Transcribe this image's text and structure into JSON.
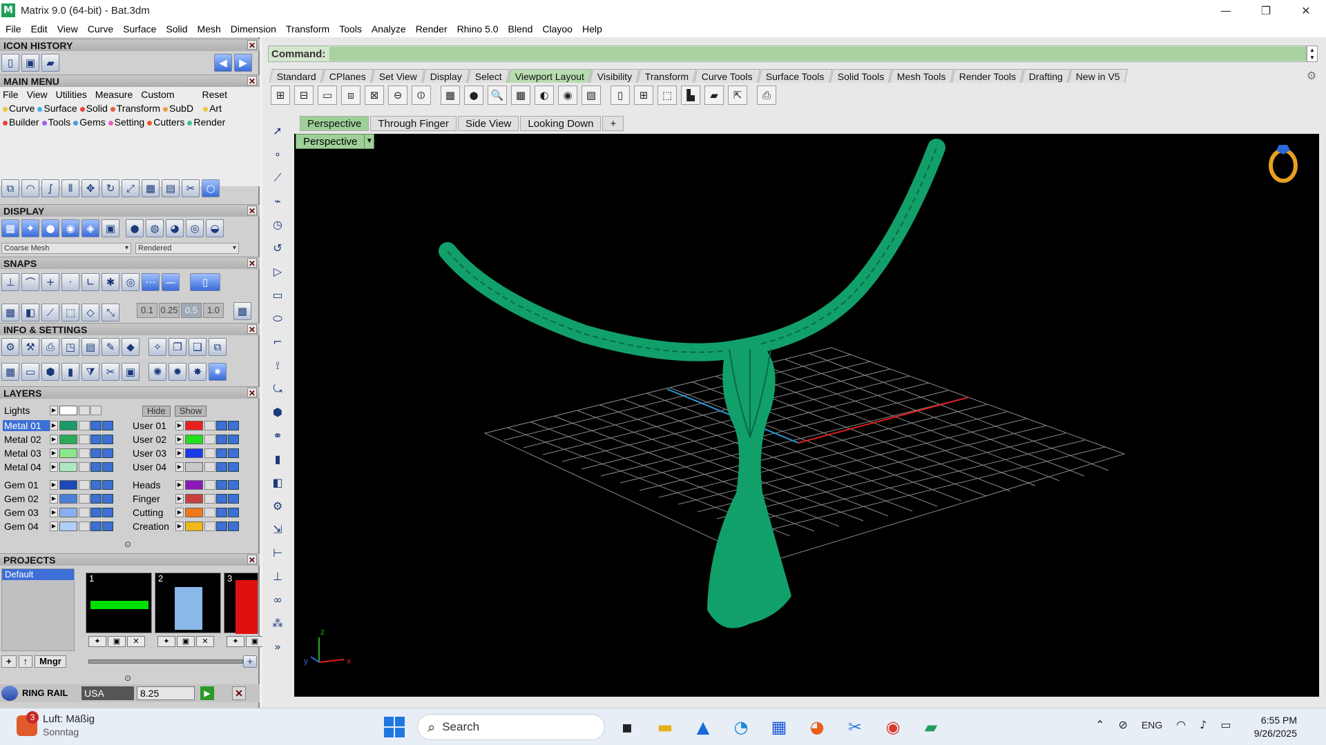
{
  "window": {
    "title": "Matrix 9.0 (64-bit) - Bat.3dm",
    "logo_glyph": "M",
    "minimize": "—",
    "maximize": "❐",
    "close": "✕"
  },
  "menubar": [
    "File",
    "Edit",
    "View",
    "Curve",
    "Surface",
    "Solid",
    "Mesh",
    "Dimension",
    "Transform",
    "Tools",
    "Analyze",
    "Render",
    "Rhino 5.0",
    "Blend",
    "Clayoo",
    "Help"
  ],
  "panels": {
    "icon_history": "ICON HISTORY",
    "main_menu": "MAIN MENU",
    "display": "DISPLAY",
    "snaps": "SNAPS",
    "info_settings": "INFO & SETTINGS",
    "layers": "LAYERS",
    "projects": "PROJECTS",
    "close": "✕"
  },
  "main_menu": {
    "row1": [
      "File",
      "View",
      "Utilities",
      "Measure",
      "Custom",
      "Reset"
    ],
    "row2": [
      {
        "label": "Curve",
        "color": "#e8c840"
      },
      {
        "label": "Surface",
        "color": "#40b0e8"
      },
      {
        "label": "Solid",
        "color": "#e84040"
      },
      {
        "label": "Transform",
        "color": "#e86040"
      },
      {
        "label": "SubD",
        "color": "#e8a040"
      },
      {
        "label": "Art",
        "color": "#e8c840"
      }
    ],
    "row3": [
      {
        "label": "Builder",
        "color": "#e84040"
      },
      {
        "label": "Tools",
        "color": "#a060e8"
      },
      {
        "label": "Gems",
        "color": "#40a0e8"
      },
      {
        "label": "Setting",
        "color": "#e860c0"
      },
      {
        "label": "Cutters",
        "color": "#e86020"
      },
      {
        "label": "Render",
        "color": "#40c0a0"
      }
    ]
  },
  "display": {
    "mesh_select": "Coarse Mesh",
    "render_select": "Rendered"
  },
  "snaps": {
    "values": [
      "0.1",
      "0.25",
      "0.5",
      "1.0"
    ],
    "selected": "0.5"
  },
  "layers": {
    "lights_label": "Lights",
    "hide": "Hide",
    "show": "Show",
    "left": [
      {
        "name": "Metal 01",
        "color": "#1a9a6a",
        "selected": true
      },
      {
        "name": "Metal 02",
        "color": "#2aaa5a"
      },
      {
        "name": "Metal 03",
        "color": "#8ae88a"
      },
      {
        "name": "Metal 04",
        "color": "#aee8c0"
      },
      {
        "name": "Gem 01",
        "color": "#1a4ab8"
      },
      {
        "name": "Gem 02",
        "color": "#4a80d8"
      },
      {
        "name": "Gem 03",
        "color": "#8ab0f0"
      },
      {
        "name": "Gem 04",
        "color": "#b0cef8"
      }
    ],
    "right": [
      {
        "name": "User 01",
        "color": "#e82020"
      },
      {
        "name": "User 02",
        "color": "#20e020"
      },
      {
        "name": "User 03",
        "color": "#1a3ae8"
      },
      {
        "name": "User 04",
        "color": "#c8c8c8"
      },
      {
        "name": "Heads",
        "color": "#8a1ab8"
      },
      {
        "name": "Finger",
        "color": "#c84040"
      },
      {
        "name": "Cutting",
        "color": "#f07818"
      },
      {
        "name": "Creation",
        "color": "#f0b818"
      }
    ]
  },
  "projects": {
    "default": "Default",
    "thumbs": [
      "1",
      "2",
      "3"
    ],
    "mgr": "Mngr"
  },
  "ring": {
    "label": "RING RAIL",
    "region": "USA",
    "size": "8.25"
  },
  "command": {
    "label": "Command:"
  },
  "toolbar_tabs": [
    "Standard",
    "CPlanes",
    "Set View",
    "Display",
    "Select",
    "Viewport Layout",
    "Visibility",
    "Transform",
    "Curve Tools",
    "Surface Tools",
    "Solid Tools",
    "Mesh Tools",
    "Render Tools",
    "Drafting",
    "New in V5"
  ],
  "active_toolbar_tab": "Viewport Layout",
  "viewport_tabs": [
    "Perspective",
    "Through Finger",
    "Side View",
    "Looking Down",
    "+"
  ],
  "viewport": {
    "label": "Perspective",
    "axis": {
      "z": "z",
      "x": "x",
      "y": "y"
    },
    "model_color": "#12a06a"
  },
  "taskbar": {
    "weather_title": "Luft: Mäßig",
    "weather_sub": "Sonntag",
    "badge": "3",
    "search": "Search",
    "lang": "ENG",
    "time": "6:55 PM",
    "date": "9/26/2025"
  }
}
